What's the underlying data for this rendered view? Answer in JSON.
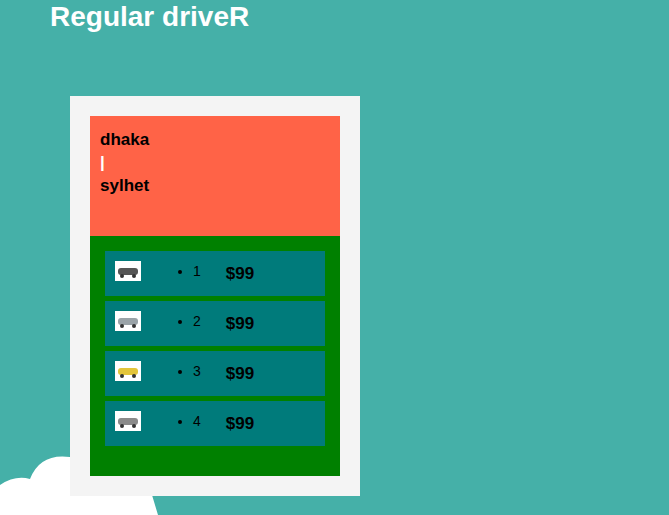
{
  "header": {
    "title": "Regular driveR"
  },
  "route": {
    "from": "dhaka",
    "separator": "|",
    "to": "sylhet"
  },
  "vehicles": [
    {
      "number": "1",
      "price": "$99"
    },
    {
      "number": "2",
      "price": "$99"
    },
    {
      "number": "3",
      "price": "$99"
    },
    {
      "number": "4",
      "price": "$99"
    }
  ]
}
